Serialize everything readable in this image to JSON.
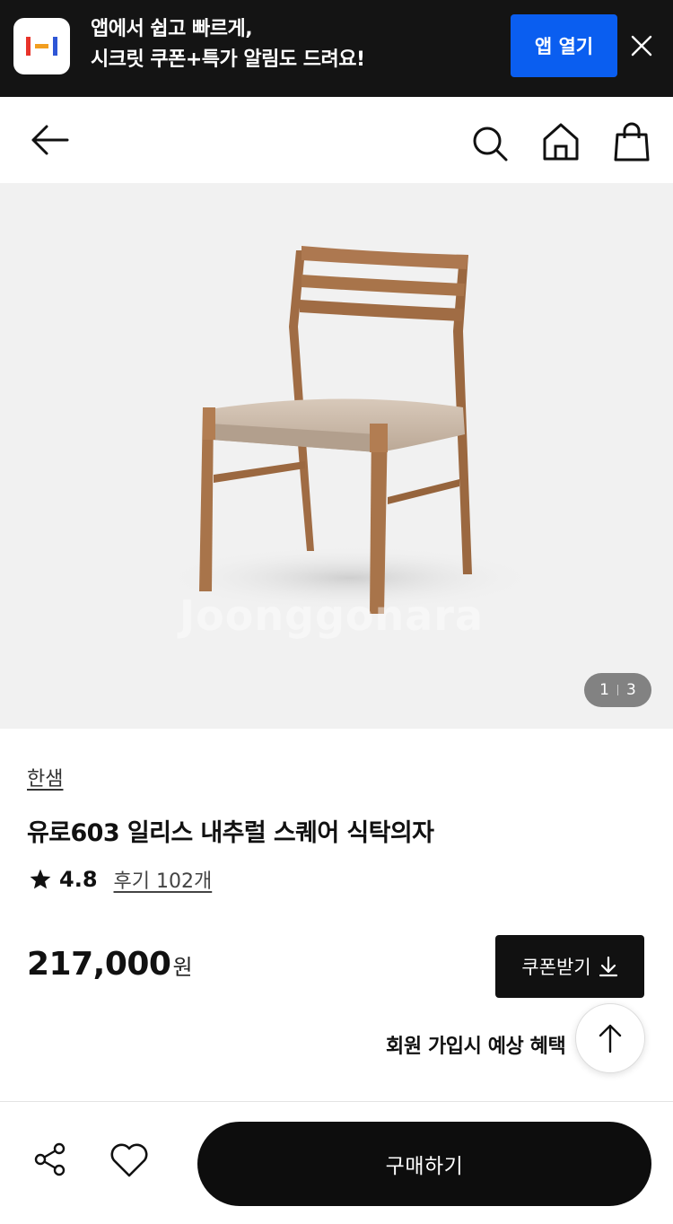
{
  "banner": {
    "line1": "앱에서 쉽고 빠르게,",
    "line2": "시크릿 쿠폰+특가 알림도 드려요!",
    "open_label": "앱 열기",
    "logo_colors": [
      "#e8332a",
      "#f29e1f",
      "#2e56d6"
    ]
  },
  "header": {
    "icons": [
      "back-arrow-icon",
      "search-icon",
      "home-icon",
      "shopping-bag-icon"
    ]
  },
  "gallery": {
    "current": "1",
    "total": "3",
    "watermark": "Joonggonara"
  },
  "product": {
    "brand": "한샘",
    "title": "유로603 일리스 내추럴 스퀘어 식탁의자",
    "rating": "4.8",
    "reviews": "후기 102개",
    "price": "217,000",
    "currency": "원",
    "coupon_label": "쿠폰받기",
    "benefit_text": "회원 가입시 예상 혜택"
  },
  "bottom": {
    "buy_label": "구매하기"
  },
  "colors": {
    "banner_bg": "#141414",
    "accent_blue": "#0a5ef0",
    "button_black": "#0d0d0d",
    "wood": "#a8744a",
    "seat": "#c9b8a8"
  }
}
